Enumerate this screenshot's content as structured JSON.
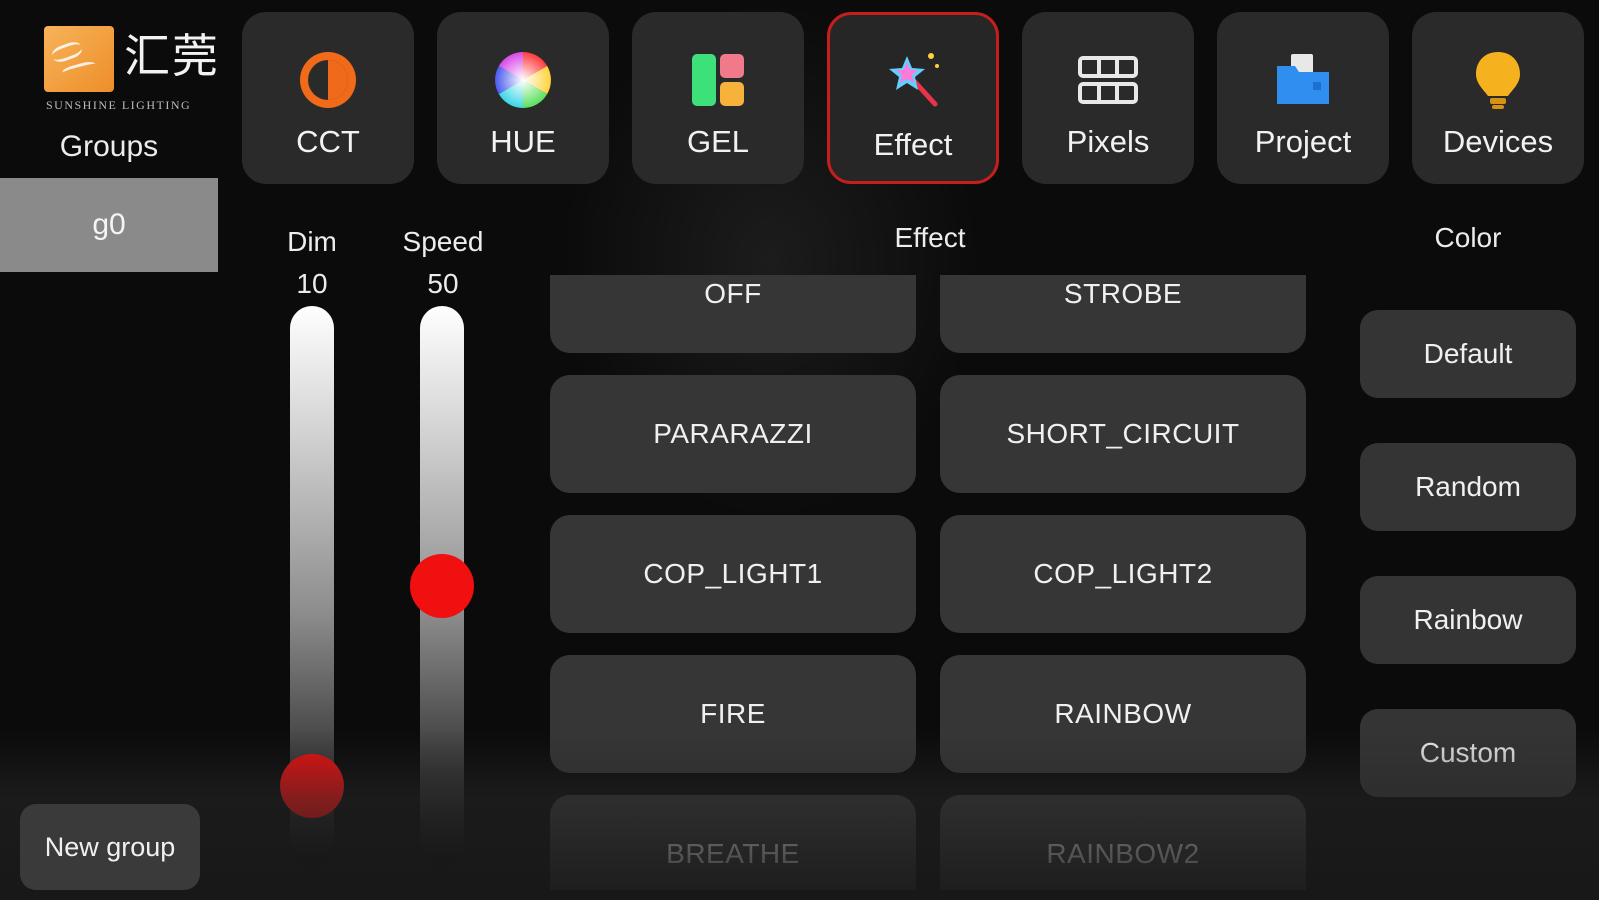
{
  "brand": {
    "name_cn": "汇莞",
    "name_en": "SUNSHINE LIGHTING"
  },
  "sidebar": {
    "title": "Groups",
    "groups": [
      "g0"
    ],
    "new_group_label": "New group"
  },
  "tabs": [
    {
      "label": "CCT",
      "icon": "cct-icon"
    },
    {
      "label": "HUE",
      "icon": "hue-wheel-icon"
    },
    {
      "label": "GEL",
      "icon": "gel-icon"
    },
    {
      "label": "Effect",
      "icon": "magic-wand-icon",
      "active": true
    },
    {
      "label": "Pixels",
      "icon": "pixels-icon"
    },
    {
      "label": "Project",
      "icon": "folder-icon"
    },
    {
      "label": "Devices",
      "icon": "lightbulb-icon"
    }
  ],
  "sliders": {
    "dim": {
      "label": "Dim",
      "value": "10",
      "fraction": 0.1
    },
    "speed": {
      "label": "Speed",
      "value": "50",
      "fraction": 0.5
    }
  },
  "effect": {
    "title": "Effect",
    "items": [
      "OFF",
      "STROBE",
      "PARARAZZI",
      "SHORT_CIRCUIT",
      "COP_LIGHT1",
      "COP_LIGHT2",
      "FIRE",
      "RAINBOW",
      "BREATHE",
      "RAINBOW2"
    ]
  },
  "color": {
    "title": "Color",
    "options": [
      "Default",
      "Random",
      "Rainbow",
      "Custom"
    ]
  },
  "colors": {
    "accent_red": "#f01010",
    "active_border": "#c41e1e",
    "button_bg": "#363636"
  }
}
